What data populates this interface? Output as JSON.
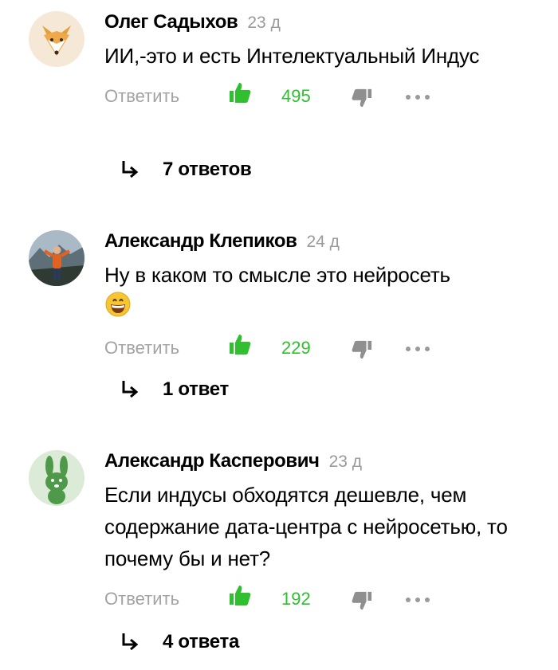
{
  "actions": {
    "reply_label": "Ответить"
  },
  "colors": {
    "like_green": "#2fbf2f",
    "muted_gray": "#9a9a9a",
    "dislike_gray": "#8f8f8f"
  },
  "comments": [
    {
      "author": "Олег Садыхов",
      "time": "23 д",
      "text": "ИИ,-это и есть Интелектуальный Индус",
      "likes": "495",
      "replies_label": "7 ответов",
      "avatar": "fox-avatar"
    },
    {
      "author": "Александр Клепиков",
      "time": "24 д",
      "text": "Ну в каком то смысле это нейросеть",
      "emoji": "grinning-face-emoji",
      "likes": "229",
      "replies_label": "1 ответ",
      "avatar": "photo-avatar"
    },
    {
      "author": "Александр Касперович",
      "time": "23 д",
      "text": "Если индусы обходятся дешевле, чем содержание дата-центра с нейросетью, то почему бы и нет?",
      "likes": "192",
      "replies_label": "4 ответа",
      "avatar": "rabbit-avatar"
    }
  ]
}
